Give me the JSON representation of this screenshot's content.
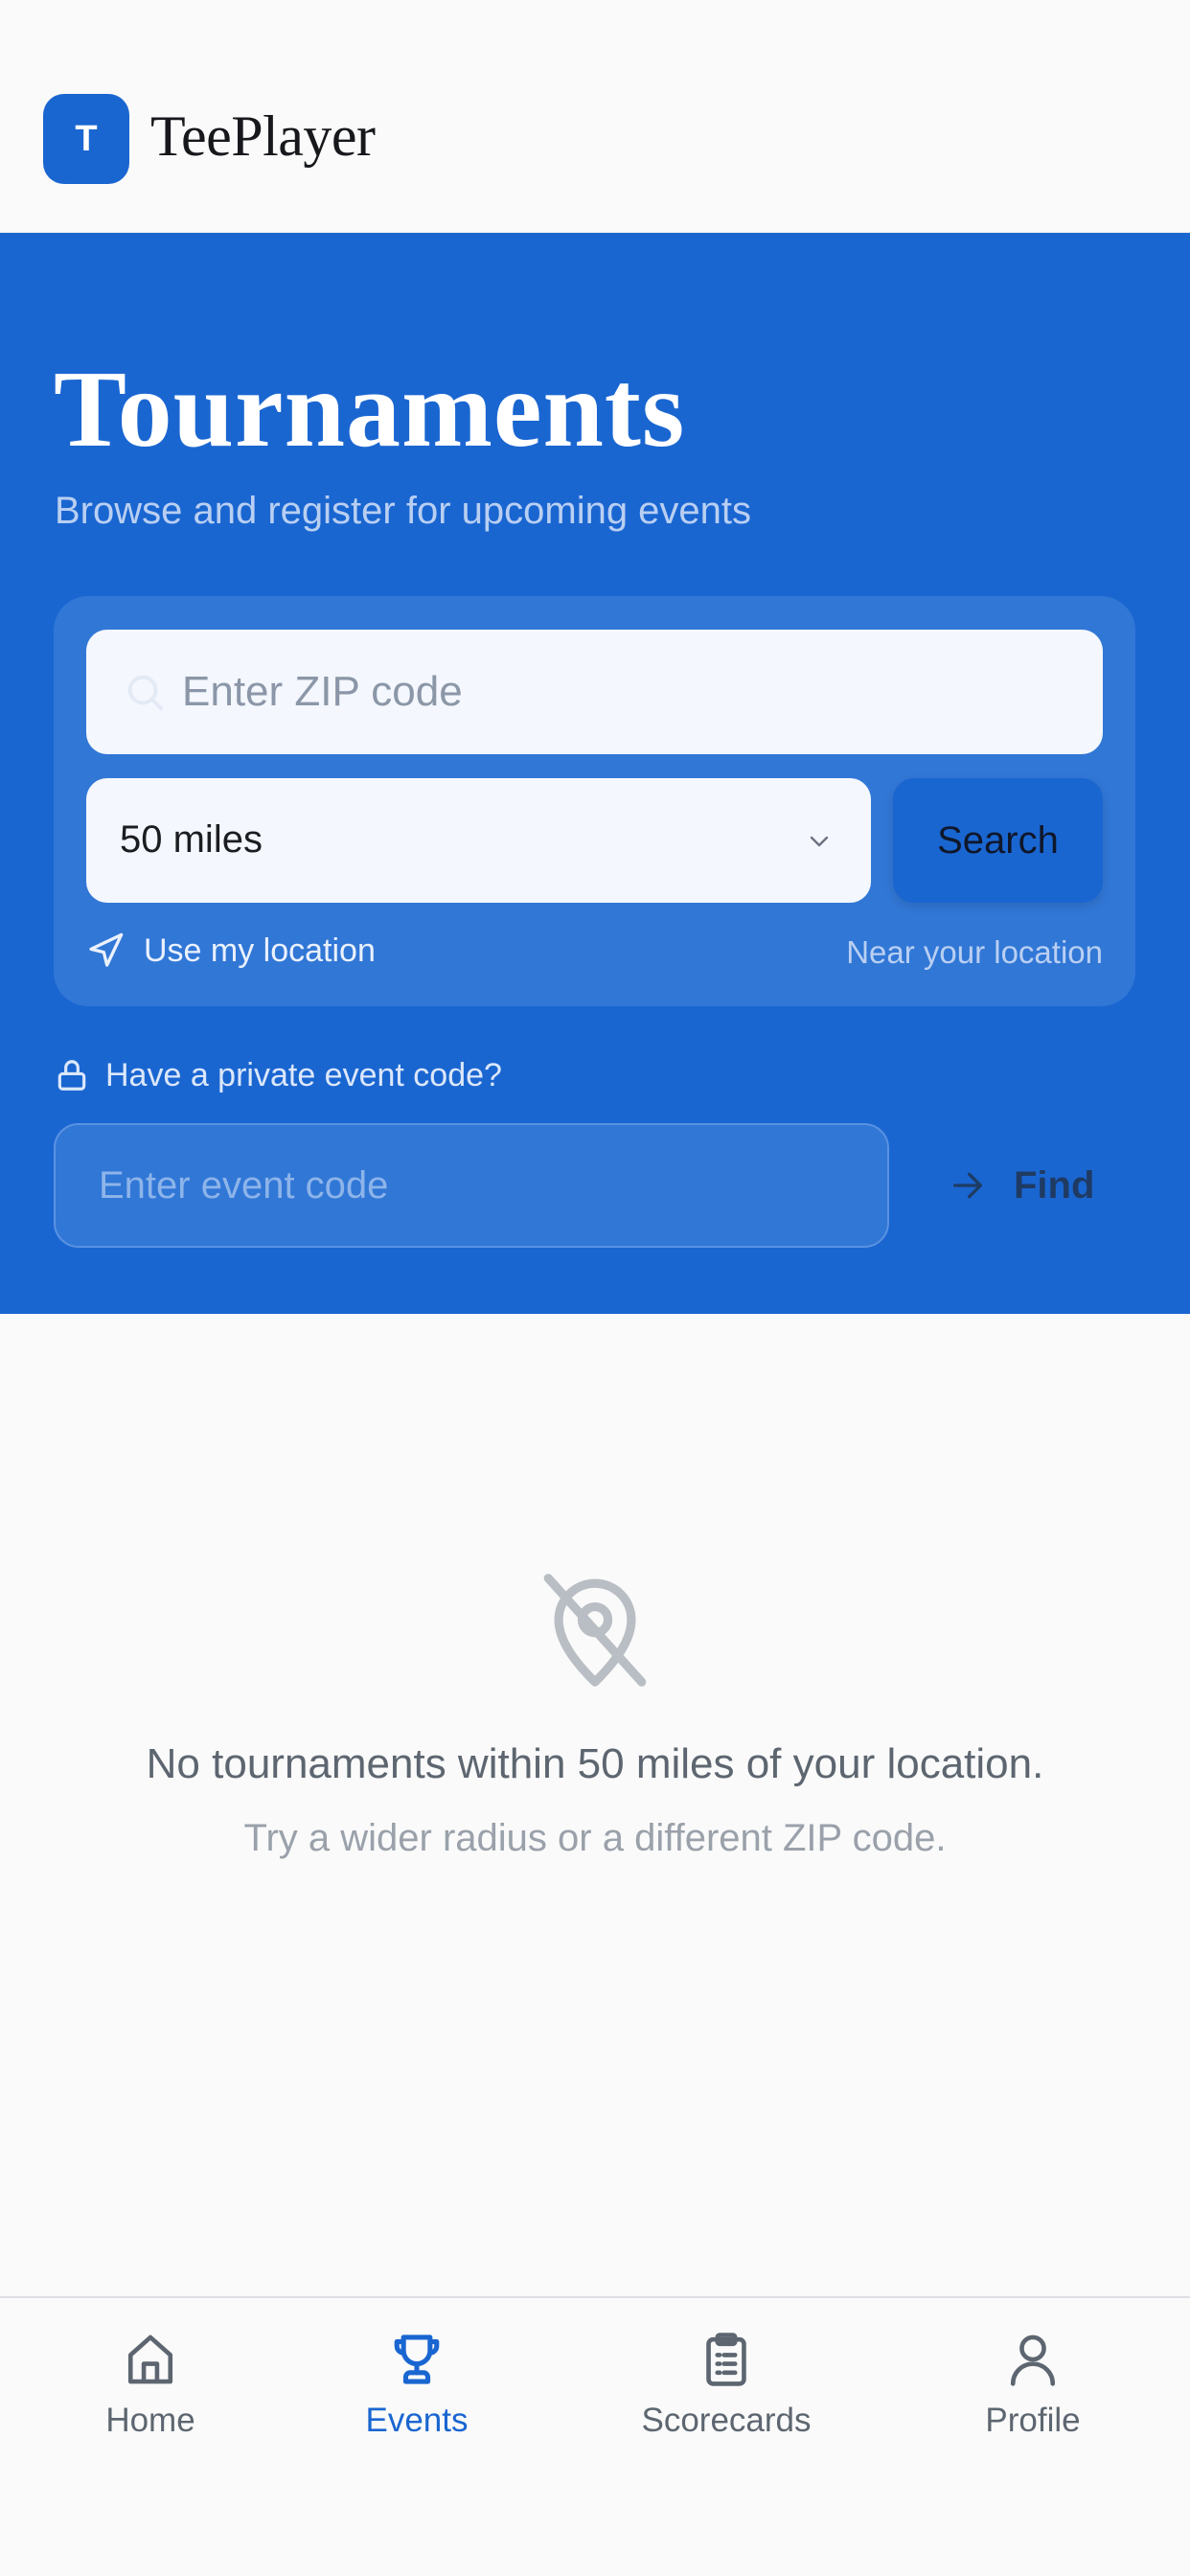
{
  "header": {
    "logo_letter": "T",
    "brand_name": "TeePlayer"
  },
  "hero": {
    "title": "Tournaments",
    "subtitle": "Browse and register for upcoming events"
  },
  "search": {
    "zip_placeholder": "Enter ZIP code",
    "radius_selected": "50 miles",
    "search_label": "Search",
    "use_location_label": "Use my location",
    "near_location_label": "Near your location"
  },
  "private_event": {
    "prompt": "Have a private event code?",
    "code_placeholder": "Enter event code",
    "find_label": "Find"
  },
  "empty_state": {
    "icon": "location-off-icon",
    "title": "No tournaments within 50 miles of your location.",
    "subtitle": "Try a wider radius or a different ZIP code."
  },
  "bottom_nav": {
    "items": [
      {
        "label": "Home",
        "icon": "home-icon",
        "active": false
      },
      {
        "label": "Events",
        "icon": "trophy-icon",
        "active": true
      },
      {
        "label": "Scorecards",
        "icon": "clipboard-icon",
        "active": false
      },
      {
        "label": "Profile",
        "icon": "user-icon",
        "active": false
      }
    ]
  },
  "colors": {
    "primary": "#1a66d1",
    "card": "#3177d6",
    "background": "#fafafa",
    "muted_text": "#5d6670"
  }
}
